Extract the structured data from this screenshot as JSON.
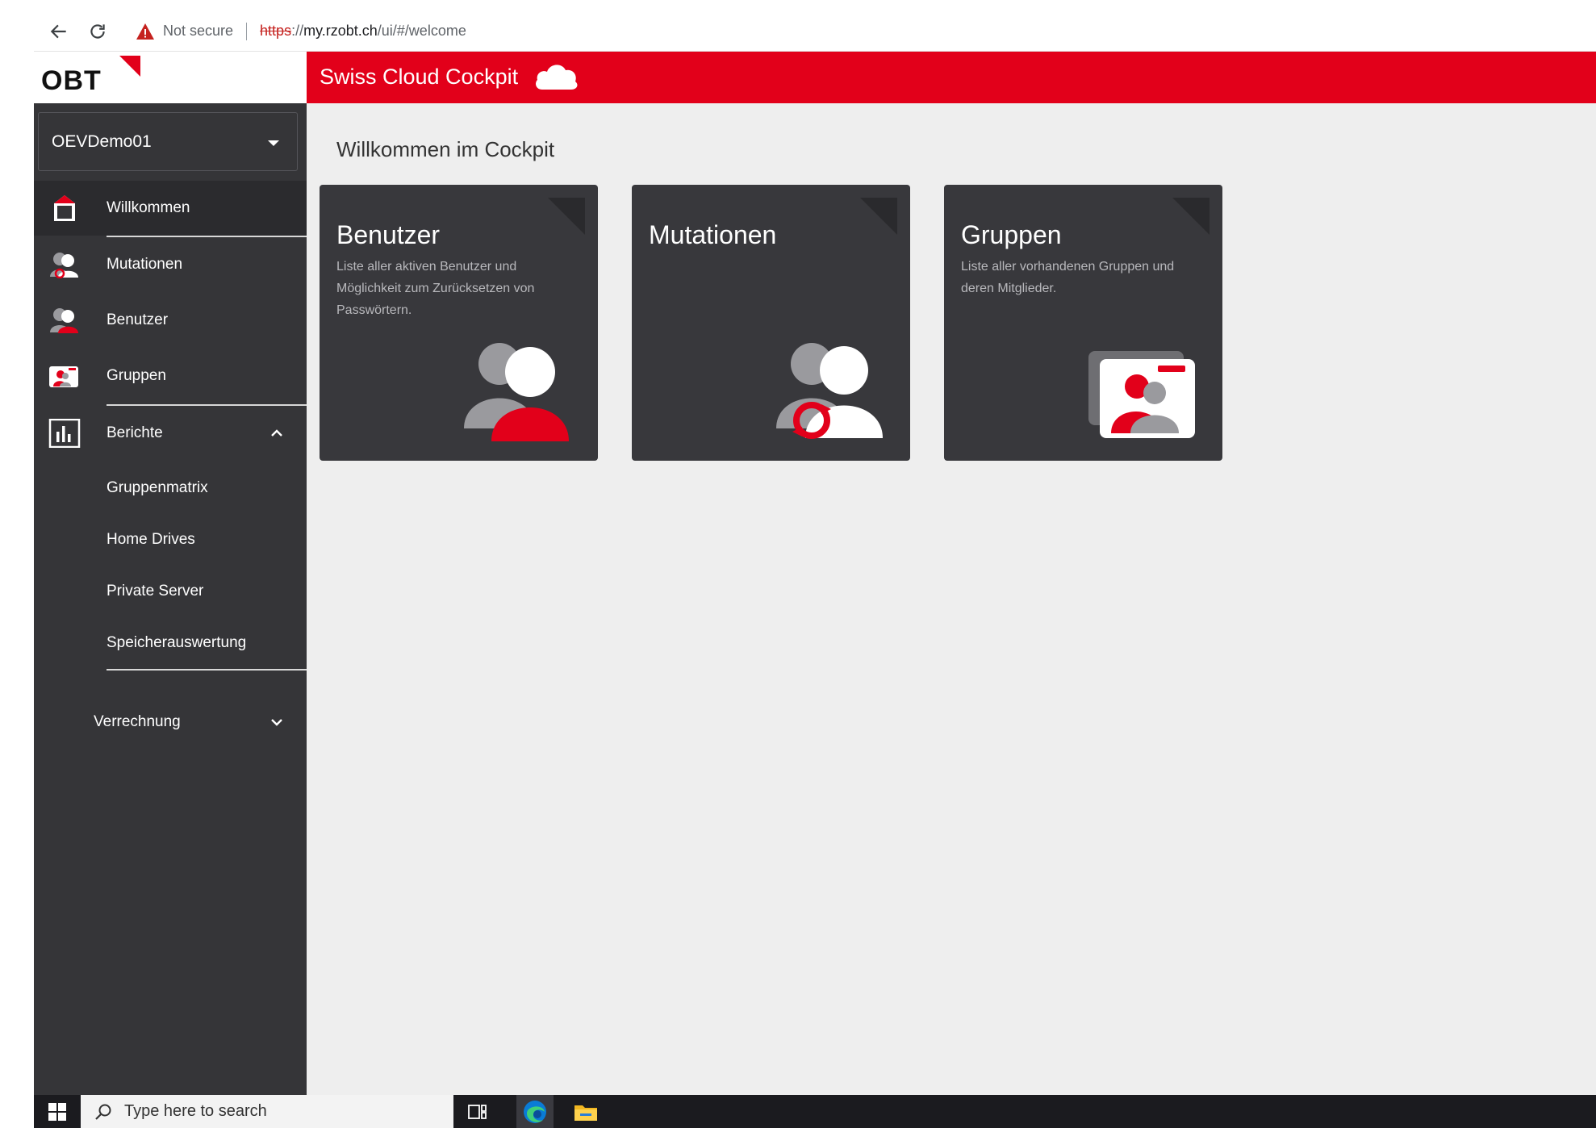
{
  "browser": {
    "not_secure": "Not secure",
    "url_scheme": "https",
    "url_scheme_sep": "://",
    "url_host": "my.rzobt.ch",
    "url_path": "/ui/#/welcome"
  },
  "logo": {
    "text": "OBT"
  },
  "header": {
    "title": "Swiss Cloud Cockpit"
  },
  "sidebar": {
    "tenant": "OEVDemo01",
    "items": [
      {
        "label": "Willkommen",
        "icon": "home-icon"
      },
      {
        "label": "Mutationen",
        "icon": "user-sync-icon"
      },
      {
        "label": "Benutzer",
        "icon": "user-icon"
      },
      {
        "label": "Gruppen",
        "icon": "group-card-icon"
      },
      {
        "label": "Berichte",
        "icon": "report-chart-icon"
      }
    ],
    "report_items": [
      "Gruppenmatrix",
      "Home Drives",
      "Private Server",
      "Speicherauswertung"
    ],
    "billing": "Verrechnung"
  },
  "main": {
    "title": "Willkommen im Cockpit",
    "tiles": [
      {
        "title": "Benutzer",
        "description": "Liste aller aktiven Benutzer und Möglichkeit zum Zurücksetzen von Passwörtern."
      },
      {
        "title": "Mutationen",
        "description": ""
      },
      {
        "title": "Gruppen",
        "description": "Liste aller vorhandenen Gruppen und deren Mitglieder."
      }
    ]
  },
  "taskbar": {
    "search_placeholder": "Type here to search"
  },
  "colors": {
    "brand_red": "#e2001a",
    "sidebar": "#353538",
    "tile": "#38383c",
    "main_bg": "#eeeeee"
  }
}
